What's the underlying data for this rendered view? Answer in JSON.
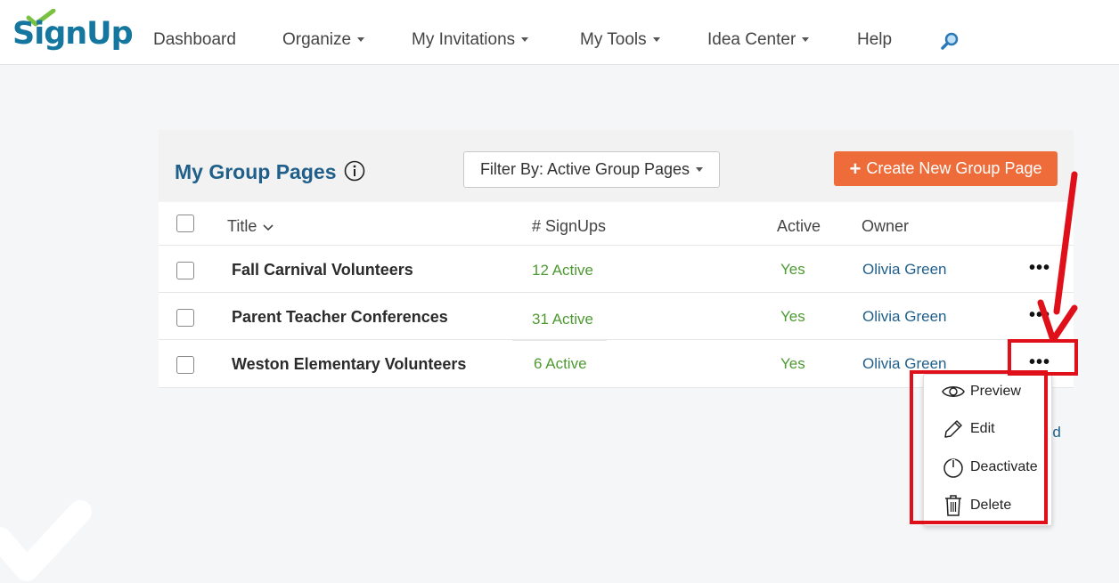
{
  "header": {
    "logo_text": "SignUp",
    "nav": [
      {
        "label": "Dashboard",
        "has_caret": false
      },
      {
        "label": "Organize",
        "has_caret": true
      },
      {
        "label": "My Invitations",
        "has_caret": true
      },
      {
        "label": "My Tools",
        "has_caret": true
      },
      {
        "label": "Idea Center",
        "has_caret": true
      },
      {
        "label": "Help",
        "has_caret": false
      }
    ],
    "search_icon": "search-icon"
  },
  "card": {
    "title": "My Group Pages",
    "filter_label": "Filter By: Active Group Pages",
    "create_label": "Create New Group Page",
    "columns": {
      "title": "Title",
      "signups": "# SignUps",
      "active": "Active",
      "owner": "Owner"
    },
    "rows": [
      {
        "title": "Fall Carnival Volunteers",
        "signups": "12 Active",
        "active": "Yes",
        "owner": "Olivia Green"
      },
      {
        "title": "Parent Teacher Conferences",
        "signups": "31 Active",
        "active": "Yes",
        "owner": "Olivia Green"
      },
      {
        "title": "Weston Elementary Volunteers",
        "signups": "6 Active",
        "active": "Yes",
        "owner": "Olivia Green"
      }
    ],
    "behind_link": "ard"
  },
  "menu": {
    "items": [
      {
        "label": "Preview",
        "icon": "eye-icon"
      },
      {
        "label": "Edit",
        "icon": "pencil-icon"
      },
      {
        "label": "Deactivate",
        "icon": "power-icon"
      },
      {
        "label": "Delete",
        "icon": "trash-icon"
      }
    ]
  },
  "colors": {
    "brand_blue": "#1577a0",
    "title_blue": "#1f5f8a",
    "orange": "#ee6c3a",
    "green": "#4e9a32",
    "annotation_red": "#e0101a"
  }
}
